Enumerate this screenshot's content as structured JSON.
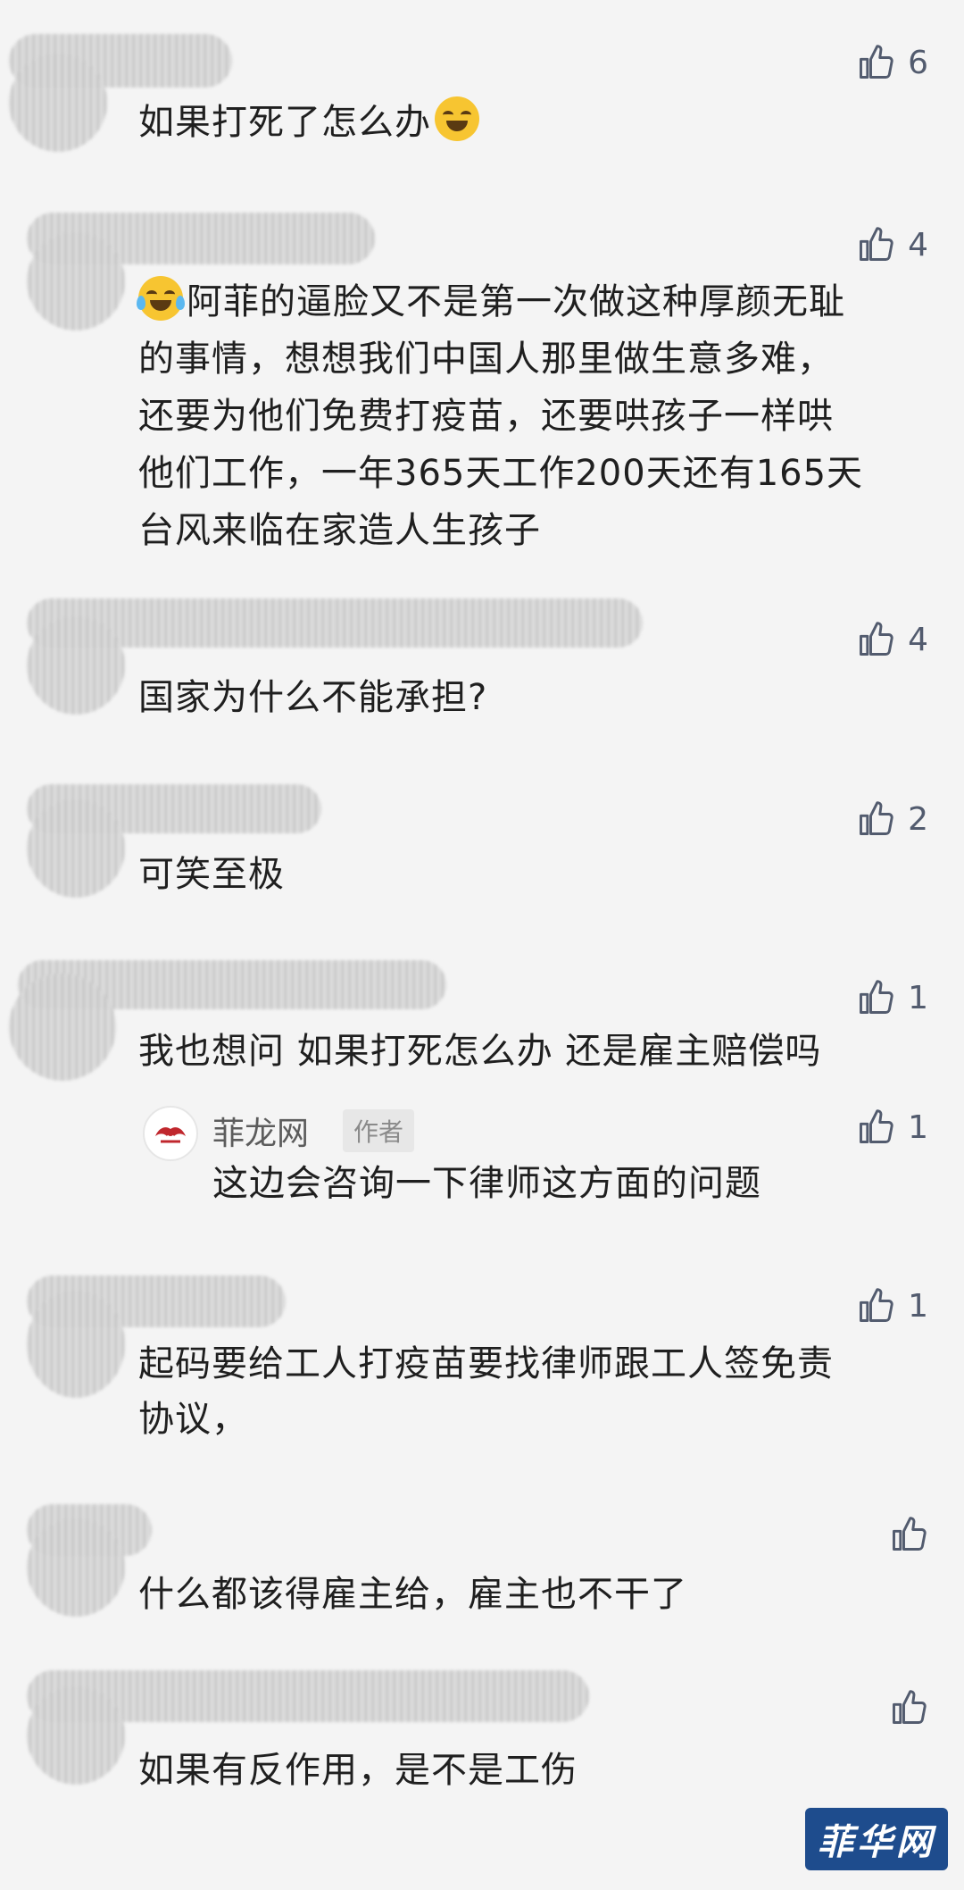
{
  "comments": [
    {
      "text": "如果打死了怎么办",
      "likes": "6"
    },
    {
      "lines": [
        "阿菲的逼脸又不是第一次做这种厚颜无耻",
        "的事情，想想我们中国人那里做生意多难，",
        "还要为他们免费打疫苗，还要哄孩子一样哄",
        "他们工作，一年365天工作200天还有165天",
        "台风来临在家造人生孩子"
      ],
      "likes": "4"
    },
    {
      "text": "国家为什么不能承担?",
      "likes": "4"
    },
    {
      "text": "可笑至极",
      "likes": "2"
    },
    {
      "text": "我也想问 如果打死怎么办 还是雇主赔偿吗",
      "likes": "1",
      "reply": {
        "name": "菲龙网",
        "tag": "作者",
        "text": "这边会咨询一下律师这方面的问题",
        "likes": "1"
      }
    },
    {
      "lines": [
        "起码要给工人打疫苗要找律师跟工人签免责",
        "协议，"
      ],
      "likes": "1"
    },
    {
      "text": "什么都该得雇主给，雇主也不干了",
      "likes": ""
    },
    {
      "text": "如果有反作用，是不是工伤",
      "likes": ""
    }
  ],
  "icons": {
    "like": "thumbs-up-icon",
    "emoji_facepalm": "facepalm-emoji",
    "emoji_laugh": "laugh-crying-emoji"
  },
  "watermark": "菲华网"
}
